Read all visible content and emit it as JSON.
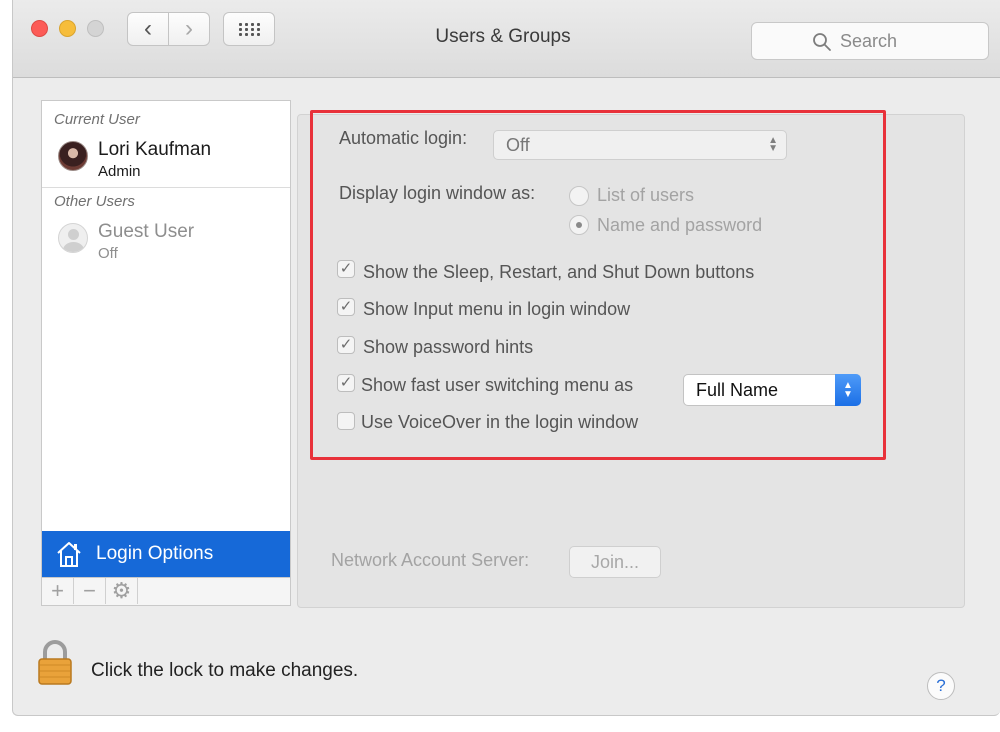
{
  "window": {
    "title": "Users & Groups"
  },
  "search": {
    "placeholder": "Search"
  },
  "sidebar": {
    "current_label": "Current User",
    "current_user": {
      "name": "Lori Kaufman",
      "role": "Admin"
    },
    "other_label": "Other Users",
    "guest_user": {
      "name": "Guest User",
      "status": "Off"
    },
    "selected_item": "Login Options",
    "toolbar": {
      "add": "+",
      "remove": "−",
      "gear": "⚙"
    }
  },
  "options": {
    "automatic_login_label": "Automatic login:",
    "automatic_login_value": "Off",
    "display_login_label": "Display login window as:",
    "radio_list_users": "List of users",
    "radio_name_password": "Name and password",
    "check_sleep": "Show the Sleep, Restart, and Shut Down buttons",
    "check_input_menu": "Show Input menu in login window",
    "check_password_hints": "Show password hints",
    "check_fast_switch": "Show fast user switching menu as",
    "fast_switch_value": "Full Name",
    "check_voiceover": "Use VoiceOver in the login window"
  },
  "network": {
    "label": "Network Account Server:",
    "join_button": "Join..."
  },
  "footer": {
    "lock_text": "Click the lock to make changes.",
    "help": "?"
  },
  "colors": {
    "selection_blue": "#1669d8",
    "highlight_red": "#e8313a"
  }
}
